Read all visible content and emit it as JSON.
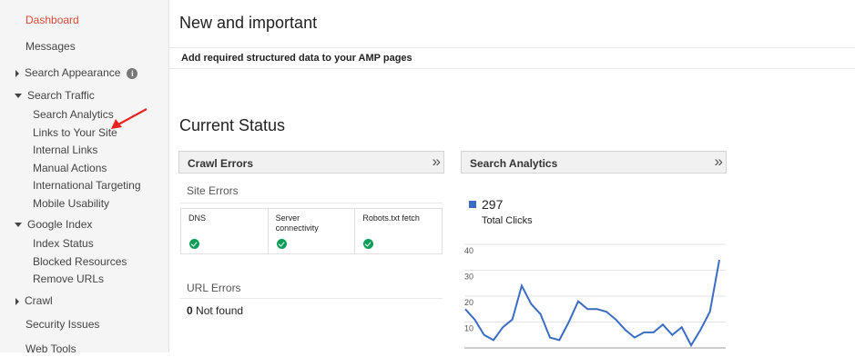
{
  "sidebar": {
    "dashboard": "Dashboard",
    "messages": "Messages",
    "search_appearance": "Search Appearance",
    "info_glyph": "i",
    "search_traffic": "Search Traffic",
    "search_traffic_items": [
      "Search Analytics",
      "Links to Your Site",
      "Internal Links",
      "Manual Actions",
      "International Targeting",
      "Mobile Usability"
    ],
    "google_index": "Google Index",
    "google_index_items": [
      "Index Status",
      "Blocked Resources",
      "Remove URLs"
    ],
    "crawl": "Crawl",
    "security_issues": "Security Issues",
    "web_tools": "Web Tools"
  },
  "main": {
    "title": "New and important",
    "notice": "Add required structured data to your AMP pages",
    "status_title": "Current Status",
    "crawl_errors": {
      "title": "Crawl Errors",
      "chevron": "»",
      "site_errors": "Site Errors",
      "columns": [
        "DNS",
        "Server connectivity",
        "Robots.txt fetch"
      ],
      "url_errors": "URL Errors",
      "not_found_count": "0",
      "not_found_label": "Not found"
    },
    "search_analytics": {
      "title": "Search Analytics",
      "chevron": "»",
      "total_value": "297",
      "total_label": "Total Clicks",
      "series_color": "#3b6cc4"
    }
  },
  "annotation": {
    "arrow_color": "#e8231f",
    "points_to": "Links to Your Site"
  },
  "colors": {
    "active": "#dd4b39",
    "check": "#0f9d58"
  },
  "chart_data": {
    "type": "line",
    "series": [
      {
        "values": [
          15,
          11,
          5,
          3,
          8,
          11,
          24,
          17,
          13,
          4,
          3,
          10,
          18,
          15,
          15,
          14,
          11,
          7,
          4,
          6,
          6,
          9,
          5,
          8,
          1,
          7,
          14,
          34
        ]
      }
    ],
    "ylim": [
      0,
      40
    ],
    "yticks": [
      10,
      20,
      30,
      40
    ],
    "grid": true
  }
}
